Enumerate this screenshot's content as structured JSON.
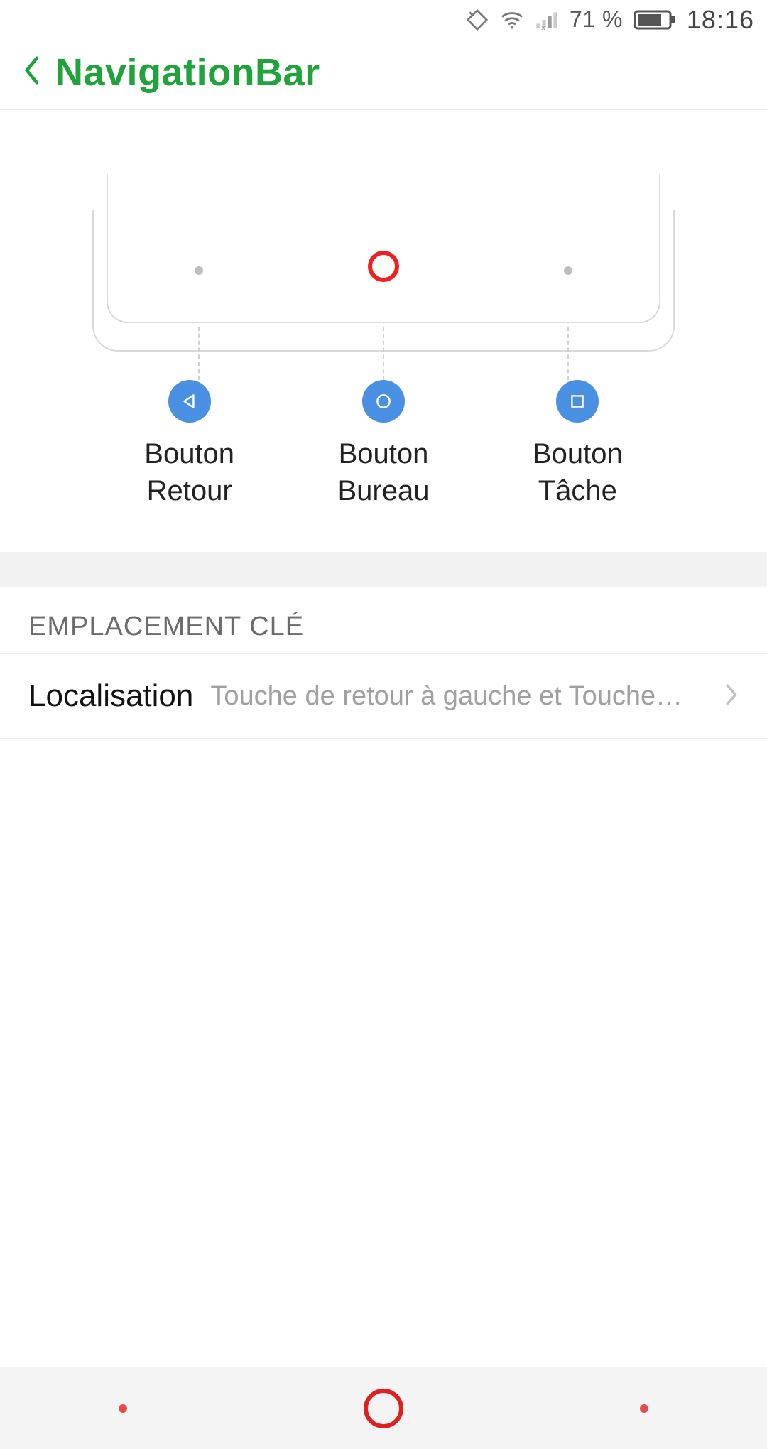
{
  "status": {
    "battery_percent": "71 %",
    "time": "18:16"
  },
  "header": {
    "title": "NavigationBar"
  },
  "preview": {
    "buttons": [
      {
        "label_line1": "Bouton",
        "label_line2": "Retour"
      },
      {
        "label_line1": "Bouton",
        "label_line2": "Bureau"
      },
      {
        "label_line1": "Bouton",
        "label_line2": "Tâche"
      }
    ]
  },
  "section": {
    "header": "EMPLACEMENT CLÉ",
    "localisation_label": "Localisation",
    "localisation_value": "Touche de retour à gauche et Touche…"
  }
}
